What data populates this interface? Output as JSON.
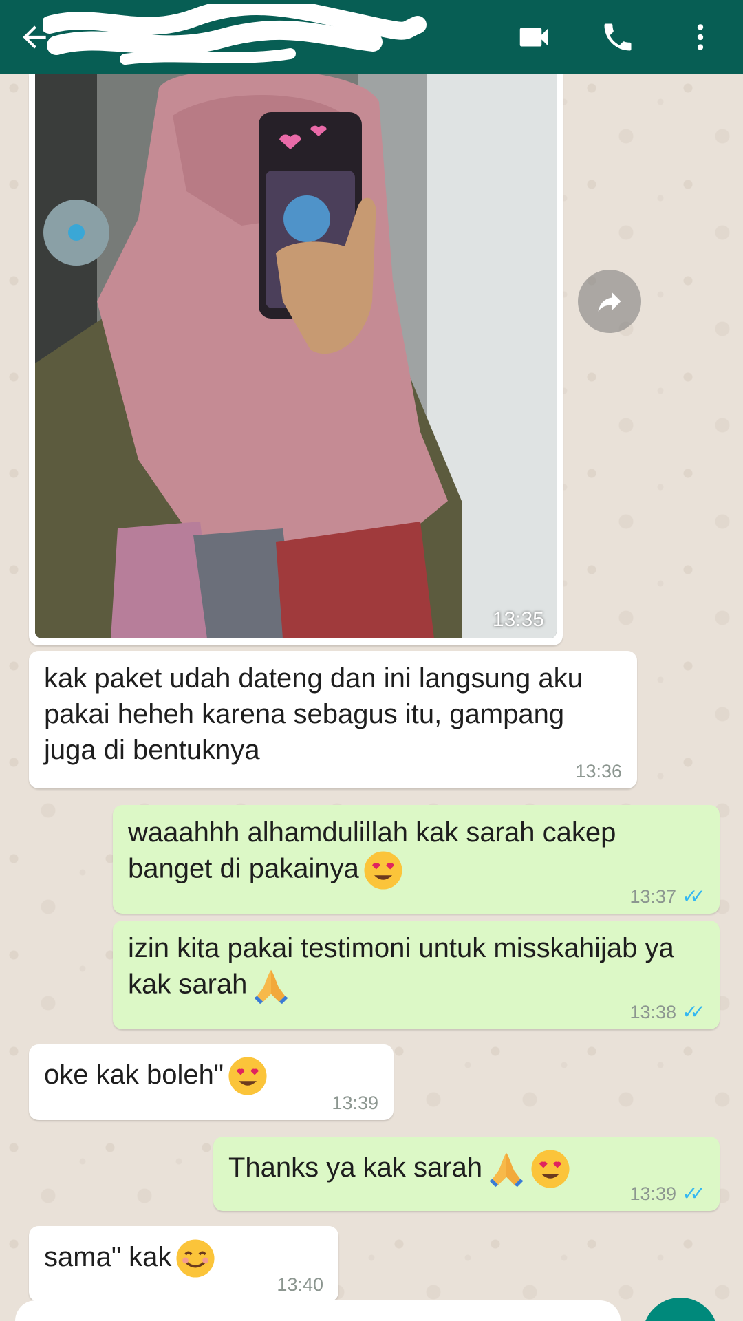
{
  "header": {
    "contact_name": "",
    "back_icon": "arrow-left-icon",
    "video_icon": "video-camera-icon",
    "call_icon": "phone-icon",
    "menu_icon": "more-vert-icon",
    "color": "#075e54"
  },
  "photo_message": {
    "time": "13:35",
    "direction": "incoming"
  },
  "messages": [
    {
      "direction": "incoming",
      "text": "kak paket udah dateng dan ini langsung aku pakai heheh karena sebagus itu, gampang juga di bentuknya",
      "time": "13:36"
    },
    {
      "direction": "outgoing",
      "text": "waaahhh alhamdulillah kak sarah cakep banget di pakainya",
      "emoji": [
        "heart-eyes"
      ],
      "time": "13:37",
      "status": "read"
    },
    {
      "direction": "outgoing",
      "text": "izin kita pakai testimoni untuk misskahijab ya kak sarah",
      "emoji": [
        "folded-hands"
      ],
      "time": "13:38",
      "status": "read"
    },
    {
      "direction": "incoming",
      "text": "oke kak boleh\"",
      "emoji": [
        "heart-eyes"
      ],
      "time": "13:39"
    },
    {
      "direction": "outgoing",
      "text": "Thanks ya kak sarah",
      "emoji": [
        "folded-hands",
        "heart-eyes"
      ],
      "time": "13:39",
      "status": "read"
    },
    {
      "direction": "incoming",
      "text": "sama\" kak",
      "emoji": [
        "smiling-face"
      ],
      "time": "13:40"
    }
  ],
  "colors": {
    "incoming_bubble": "#ffffff",
    "outgoing_bubble": "#dcf8c6",
    "read_ticks": "#34b7f1",
    "wallpaper": "#e9e1d8"
  }
}
